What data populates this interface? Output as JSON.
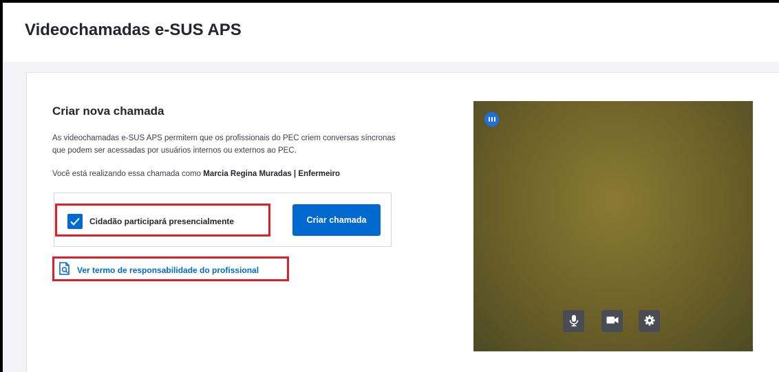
{
  "header": {
    "title": "Videochamadas e-SUS APS"
  },
  "card": {
    "title": "Criar nova chamada",
    "description": "As videochamadas e-SUS APS permitem que os profissionais do PEC criem conversas síncronas que podem ser acessadas por usuários internos ou externos ao PEC.",
    "role_prefix": "Você está realizando essa chamada como",
    "role_value": "Marcia Regina Muradas | Enfermeiro"
  },
  "actions": {
    "checkbox_label": "Cidadão participará presencialmente",
    "checkbox_checked": true,
    "create_button": "Criar chamada",
    "terms_link": "Ver termo de responsabilidade do profissional"
  },
  "video": {
    "controls": [
      "microphone-icon",
      "camera-icon",
      "settings-gear-icon"
    ]
  },
  "colors": {
    "primary": "#0069d0",
    "highlight": "#e01d2a",
    "page_background": "#f2f2f7"
  }
}
